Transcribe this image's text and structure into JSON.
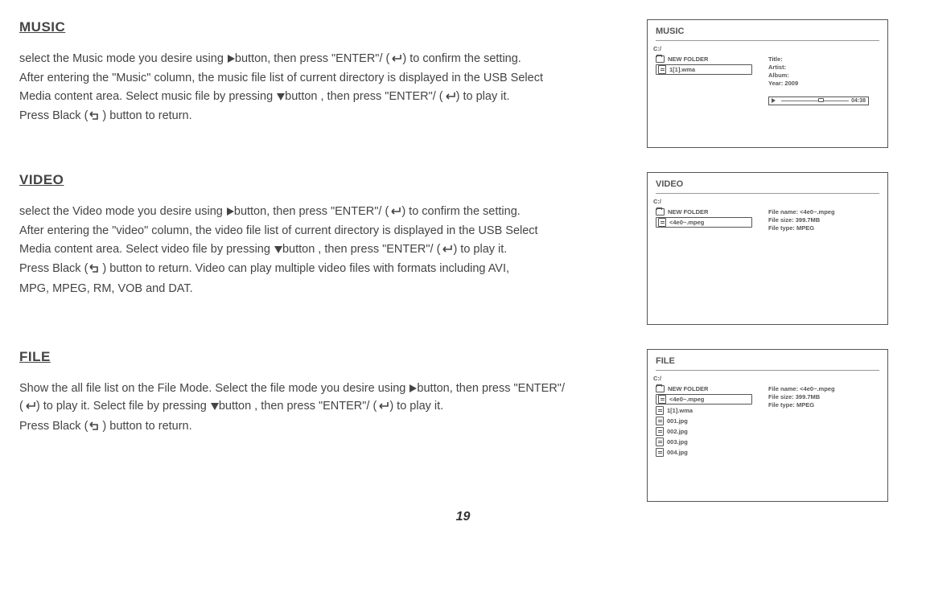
{
  "page_number": "19",
  "sections": {
    "music": {
      "heading": "MUSIC",
      "p1a": "select the Music mode you desire using ",
      "p1b": "button, then press \"ENTER\"/ (",
      "p1c": ") to confirm the setting.",
      "p2": "After entering the \"Music\" column, the music file list of current directory is displayed in the USB Select",
      "p3a": "Media content area. Select music file by pressing ",
      "p3b": "button , then press \"ENTER\"/ (",
      "p3c": ") to play it.",
      "p4a": "Press Black (",
      "p4b": ") button to return."
    },
    "video": {
      "heading": "VIDEO",
      "p1a": "select the Video mode you desire using ",
      "p1b": "button, then press \"ENTER\"/ (",
      "p1c": ") to confirm the setting.",
      "p2": "After entering the \"video\" column, the video file list of current directory is displayed in the USB Select",
      "p3a": "Media content area. Select video file by pressing ",
      "p3b": "button , then press \"ENTER\"/ (",
      "p3c": ") to play it.",
      "p4a": "Press Black (",
      "p4b": ") button to return. Video can play multiple video files with formats including AVI,",
      "p5": "MPG, MPEG, RM, VOB and DAT."
    },
    "file": {
      "heading": "FILE",
      "p1a": "Show the all file list on the File Mode. Select the file mode you desire using ",
      "p1b": "button, then press \"ENTER\"/",
      "p2a": "(",
      "p2b": ") to play it. Select file by pressing ",
      "p2c": "button , then press \"ENTER\"/ (",
      "p2d": ") to play it.",
      "p3a": "Press Black (",
      "p3b": ") button to return."
    }
  },
  "panels": {
    "music": {
      "title": "MUSIC",
      "path": "C:/",
      "folder": "NEW FOLDER",
      "file": "1[1].wma",
      "meta1": "Title:",
      "meta2": "Artist:",
      "meta3": "Album:",
      "meta4": "Year: 2009",
      "duration": "04:38"
    },
    "video": {
      "title": "VIDEO",
      "path": "C:/",
      "folder": "NEW FOLDER",
      "file": "<4e0~.mpeg",
      "meta1": "File name: <4e0~.mpeg",
      "meta2": "File size: 399.7MB",
      "meta3": "File type: MPEG"
    },
    "file": {
      "title": "FILE",
      "path": "C:/",
      "items": {
        "i0": "NEW FOLDER",
        "i1": "<4e0~.mpeg",
        "i2": "1[1].wma",
        "i3": "001.jpg",
        "i4": "002.jpg",
        "i5": "003.jpg",
        "i6": "004.jpg"
      },
      "meta1": "File name: <4e0~.mpeg",
      "meta2": "File size: 399.7MB",
      "meta3": "File type: MPEG"
    }
  }
}
